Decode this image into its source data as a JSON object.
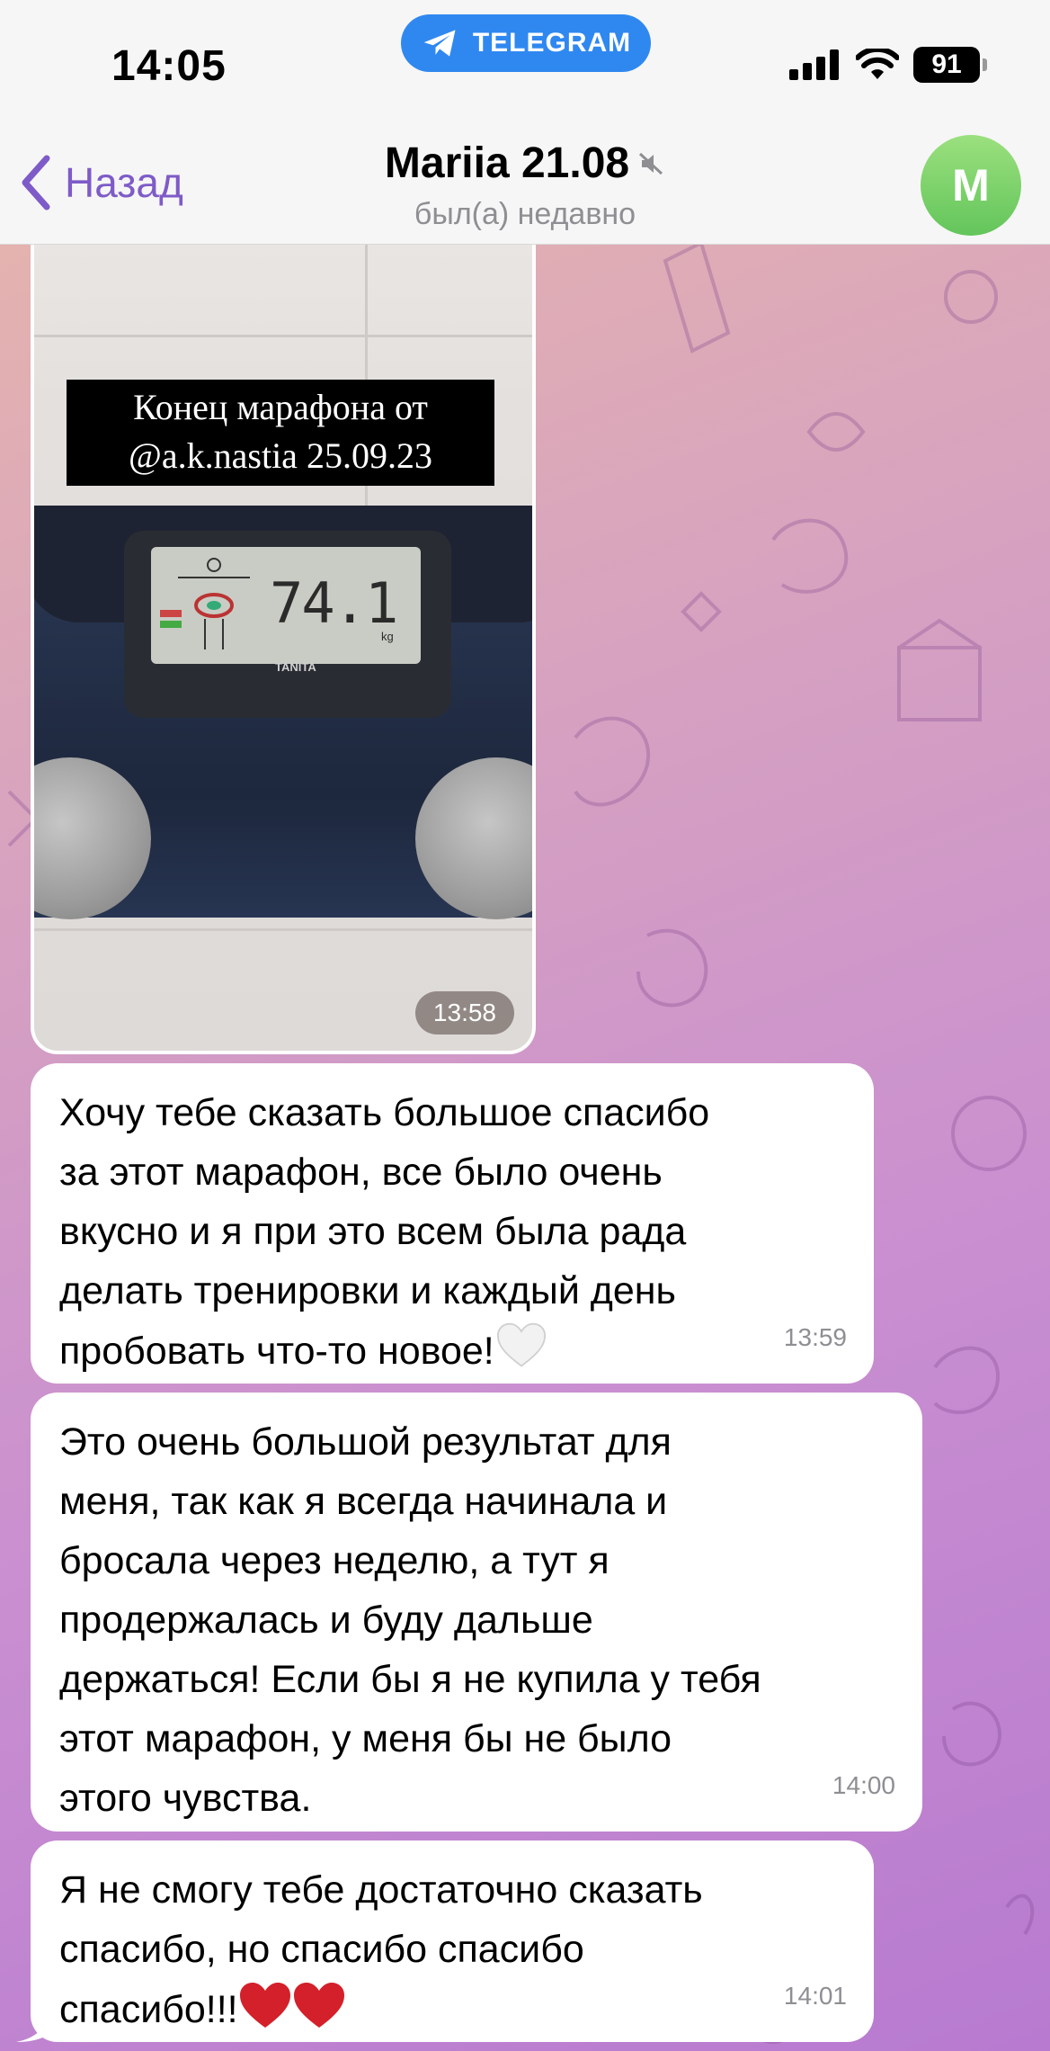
{
  "status_bar": {
    "time": "14:05",
    "app_pill": "TELEGRAM",
    "battery": "91"
  },
  "header": {
    "back_label": "Назад",
    "chat_name": "Mariia 21.08",
    "chat_status": "был(а) недавно",
    "avatar_initial": "M"
  },
  "photo_message": {
    "caption": "Конец марафона от\n@a.k.nastia 25.09.23",
    "scale_reading": "74.1",
    "scale_unit": "kg",
    "scale_brand": "TANITA",
    "time": "13:58"
  },
  "messages": [
    {
      "text": "Хочу тебе сказать большое спасибо\nза этот марафон, все было очень\nвкусно и я при это всем была рада\nделать тренировки и каждый день\nпробовать что-то новое!",
      "emoji": "white-heart",
      "time": "13:59"
    },
    {
      "text": "Это очень большой результат для\nменя, так как я всегда начинала и\nбросала через неделю, а тут я\nпродержалась и буду дальше\nдержаться! Если бы я не купила у тебя\nэтот марафон, у меня бы не было\nэтого чувства.",
      "time": "14:00"
    },
    {
      "text": "Я не смогу тебе достаточно сказать\nспасибо, но спасибо спасибо\nспасибо!!!",
      "emoji": "red-heart-x2",
      "time": "14:01"
    }
  ],
  "colors": {
    "accent": "#7e5bc8",
    "telegram_blue": "#2f88f0",
    "avatar_green": "#63c55b",
    "bubble_bg": "#ffffff"
  }
}
